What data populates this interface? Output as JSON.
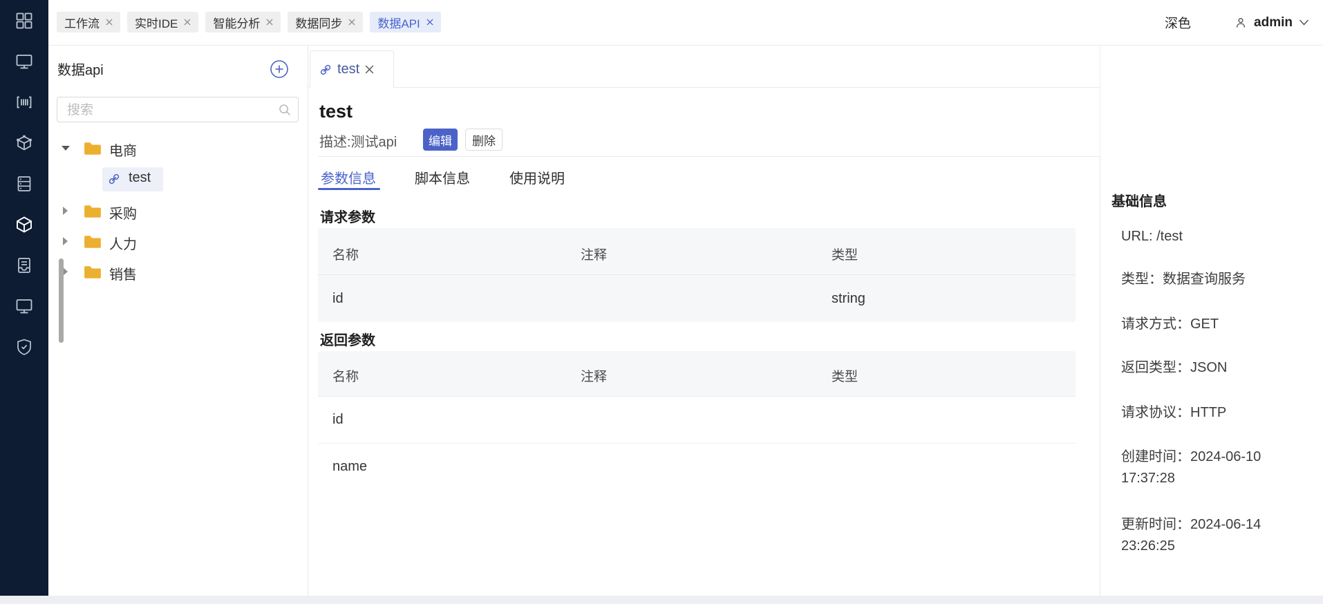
{
  "topbar": {
    "workspace_tabs": [
      {
        "label": "工作流"
      },
      {
        "label": "实时IDE"
      },
      {
        "label": "智能分析"
      },
      {
        "label": "数据同步"
      },
      {
        "label": "数据API",
        "active": true
      }
    ],
    "theme_label": "深色",
    "username": "admin"
  },
  "nav_icons": [
    "apps-grid",
    "monitor",
    "barcode",
    "cube-nodes",
    "server",
    "cube",
    "archive-doc",
    "monitor",
    "shield-check"
  ],
  "explorer": {
    "title": "数据api",
    "search_placeholder": "搜索",
    "tree": {
      "folders": [
        {
          "label": "电商",
          "expanded": true
        },
        {
          "label": "采购",
          "expanded": false
        },
        {
          "label": "人力",
          "expanded": false
        },
        {
          "label": "销售",
          "expanded": false
        }
      ],
      "selected_item": {
        "label": "test"
      }
    }
  },
  "detail": {
    "tab_label": "test",
    "title": "test",
    "description": "描述:测试api",
    "edit_label": "编辑",
    "delete_label": "删除",
    "tabs": [
      {
        "label": "参数信息",
        "active": true
      },
      {
        "label": "脚本信息"
      },
      {
        "label": "使用说明"
      }
    ],
    "request_params": {
      "heading": "请求参数",
      "columns": [
        "名称",
        "注释",
        "类型"
      ],
      "rows": [
        {
          "name": "id",
          "comment": "",
          "type": "string"
        }
      ]
    },
    "response_params": {
      "heading": "返回参数",
      "columns": [
        "名称",
        "注释",
        "类型"
      ],
      "rows": [
        {
          "name": "id",
          "comment": "",
          "type": ""
        },
        {
          "name": "name",
          "comment": "",
          "type": ""
        }
      ]
    }
  },
  "info": {
    "heading": "基础信息",
    "items": [
      {
        "lines": [
          "URL: /test"
        ]
      },
      {
        "lines": [
          "类型：数据查询服务"
        ]
      },
      {
        "lines": [
          "请求方式：GET"
        ]
      },
      {
        "lines": [
          "返回类型：JSON"
        ]
      },
      {
        "lines": [
          "请求协议：HTTP"
        ]
      },
      {
        "lines": [
          "创建时间：2024-06-10",
          "17:37:28"
        ]
      },
      {
        "lines": [
          "更新时间：2024-06-14",
          "23:26:25"
        ]
      }
    ]
  },
  "colors": {
    "accent": "#4b63c8",
    "active_tab_bg": "#e7ecfa",
    "sidebar_bg": "#0d1b33",
    "folder_yellow": "#ecb030",
    "table_bg": "#f6f7f9"
  }
}
